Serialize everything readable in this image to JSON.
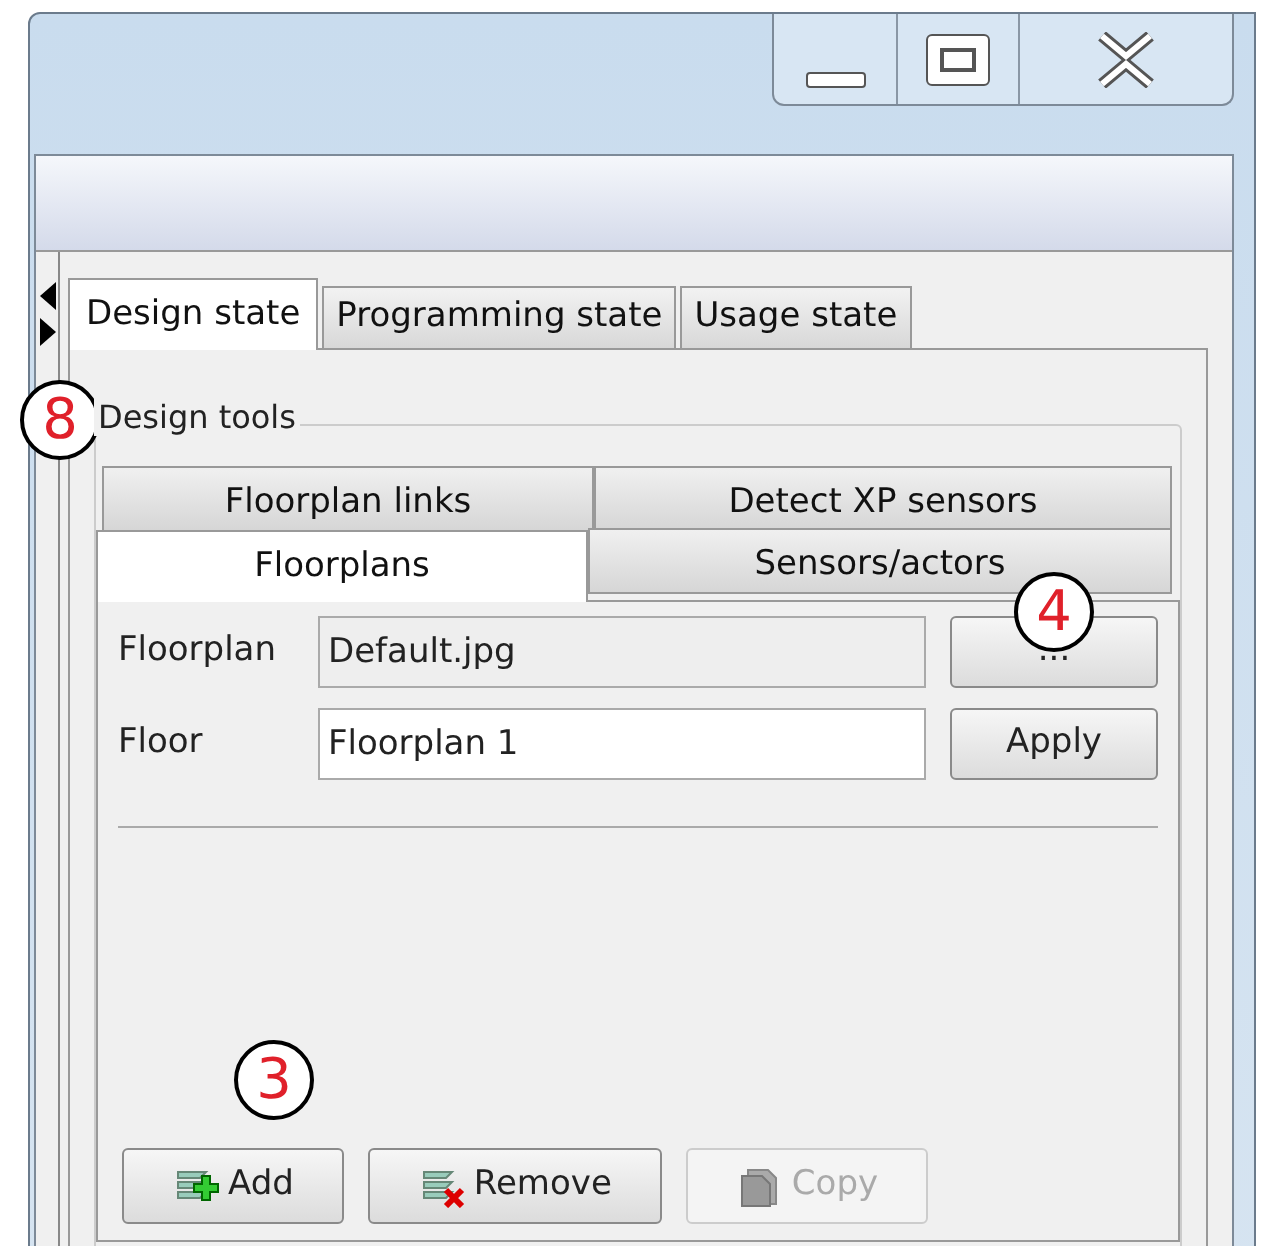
{
  "tabs": [
    {
      "label": "Design state",
      "selected": true
    },
    {
      "label": "Programming state",
      "selected": false
    },
    {
      "label": "Usage state",
      "selected": false
    }
  ],
  "group": {
    "title": "Design tools",
    "tab_rows": [
      [
        {
          "label": "Floorplan links",
          "selected": false
        },
        {
          "label": "Detect XP sensors",
          "selected": false
        }
      ],
      [
        {
          "label": "Floorplans",
          "selected": true
        },
        {
          "label": "Sensors/actors",
          "selected": false
        }
      ]
    ],
    "fields": [
      {
        "label": "Floorplan",
        "value": "Default.jpg",
        "readonly": true,
        "button": "..."
      },
      {
        "label": "Floor",
        "value": "Floorplan 1",
        "readonly": false,
        "button": "Apply"
      }
    ],
    "actions": [
      {
        "label": "Add",
        "kind": "add",
        "disabled": false
      },
      {
        "label": "Remove",
        "kind": "remove",
        "disabled": false
      },
      {
        "label": "Copy",
        "kind": "copy",
        "disabled": true
      }
    ]
  },
  "callouts": [
    {
      "label": "8"
    },
    {
      "label": "4"
    },
    {
      "label": "3"
    }
  ]
}
